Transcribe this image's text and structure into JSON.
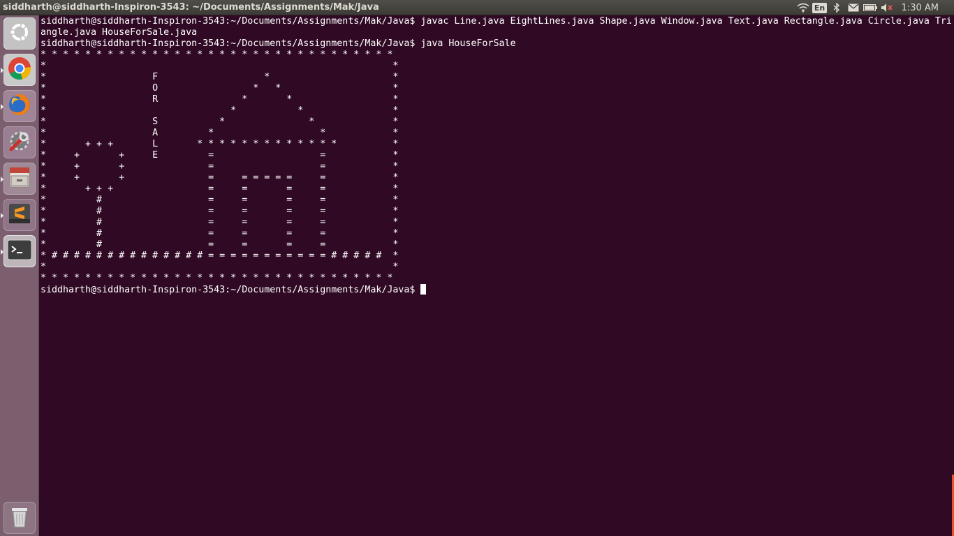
{
  "topbar": {
    "title": "siddharth@siddharth-Inspiron-3543: ~/Documents/Assignments/Mak/Java",
    "keyboard_layout": "En",
    "clock": "1:30 AM",
    "icons": [
      "wifi-icon",
      "keyboard-layout-indicator",
      "bluetooth-icon",
      "mail-icon",
      "battery-icon",
      "volume-muted-icon"
    ]
  },
  "launcher": {
    "items": [
      {
        "name": "ubuntu-dash",
        "icon": "ubuntu-logo-icon"
      },
      {
        "name": "google-chrome",
        "icon": "chrome-icon"
      },
      {
        "name": "firefox",
        "icon": "firefox-icon"
      },
      {
        "name": "system-settings",
        "icon": "settings-wrench-icon"
      },
      {
        "name": "files",
        "icon": "file-cabinet-icon"
      },
      {
        "name": "sublime-text",
        "icon": "sublime-text-icon"
      },
      {
        "name": "terminal",
        "icon": "terminal-icon"
      },
      {
        "name": "trash",
        "icon": "trash-icon"
      }
    ]
  },
  "terminal": {
    "lines": [
      "siddharth@siddharth-Inspiron-3543:~/Documents/Assignments/Mak/Java$ javac Line.java EightLines.java Shape.java Window.java Text.java Rectangle.java Circle.java Tri",
      "angle.java HouseForSale.java",
      "siddharth@siddharth-Inspiron-3543:~/Documents/Assignments/Mak/Java$ java HouseForSale"
    ],
    "art": [
      "* * * * * * * * * * * * * * * * * * * * * * * * * * * * * * * *",
      "*                                                              *",
      "*                   F                   *                      *",
      "*                   O                 *   *                    *",
      "*                   R               *       *                  *",
      "*                                 *           *                *",
      "*                   S           *               *              *",
      "*                   A         *                   *            *",
      "*       + + +       L       * * * * * * * * * * * * *          *",
      "*     +       +     E         =                   =            *",
      "*     +       +               =                   =            *",
      "*     +       +               =     = = = = =     =            *",
      "*       + + +                 =     =       =     =            *",
      "*         #                   =     =       =     =            *",
      "*         #                   =     =       =     =            *",
      "*         #                   =     =       =     =            *",
      "*         #                   =     =       =     =            *",
      "*         #                   =     =       =     =            *",
      "* # # # # # # # # # # # # # # = = = = = = = = = = = # # # # #  *",
      "*                                                              *",
      "* * * * * * * * * * * * * * * * * * * * * * * * * * * * * * * *"
    ],
    "final_prompt": "siddharth@siddharth-Inspiron-3543:~/Documents/Assignments/Mak/Java$"
  },
  "colors": {
    "terminal_bg": "#300a24",
    "terminal_fg": "#ffffff",
    "panel_bg": "#3c3b37",
    "launcher_bg": "#7b5f6f"
  }
}
